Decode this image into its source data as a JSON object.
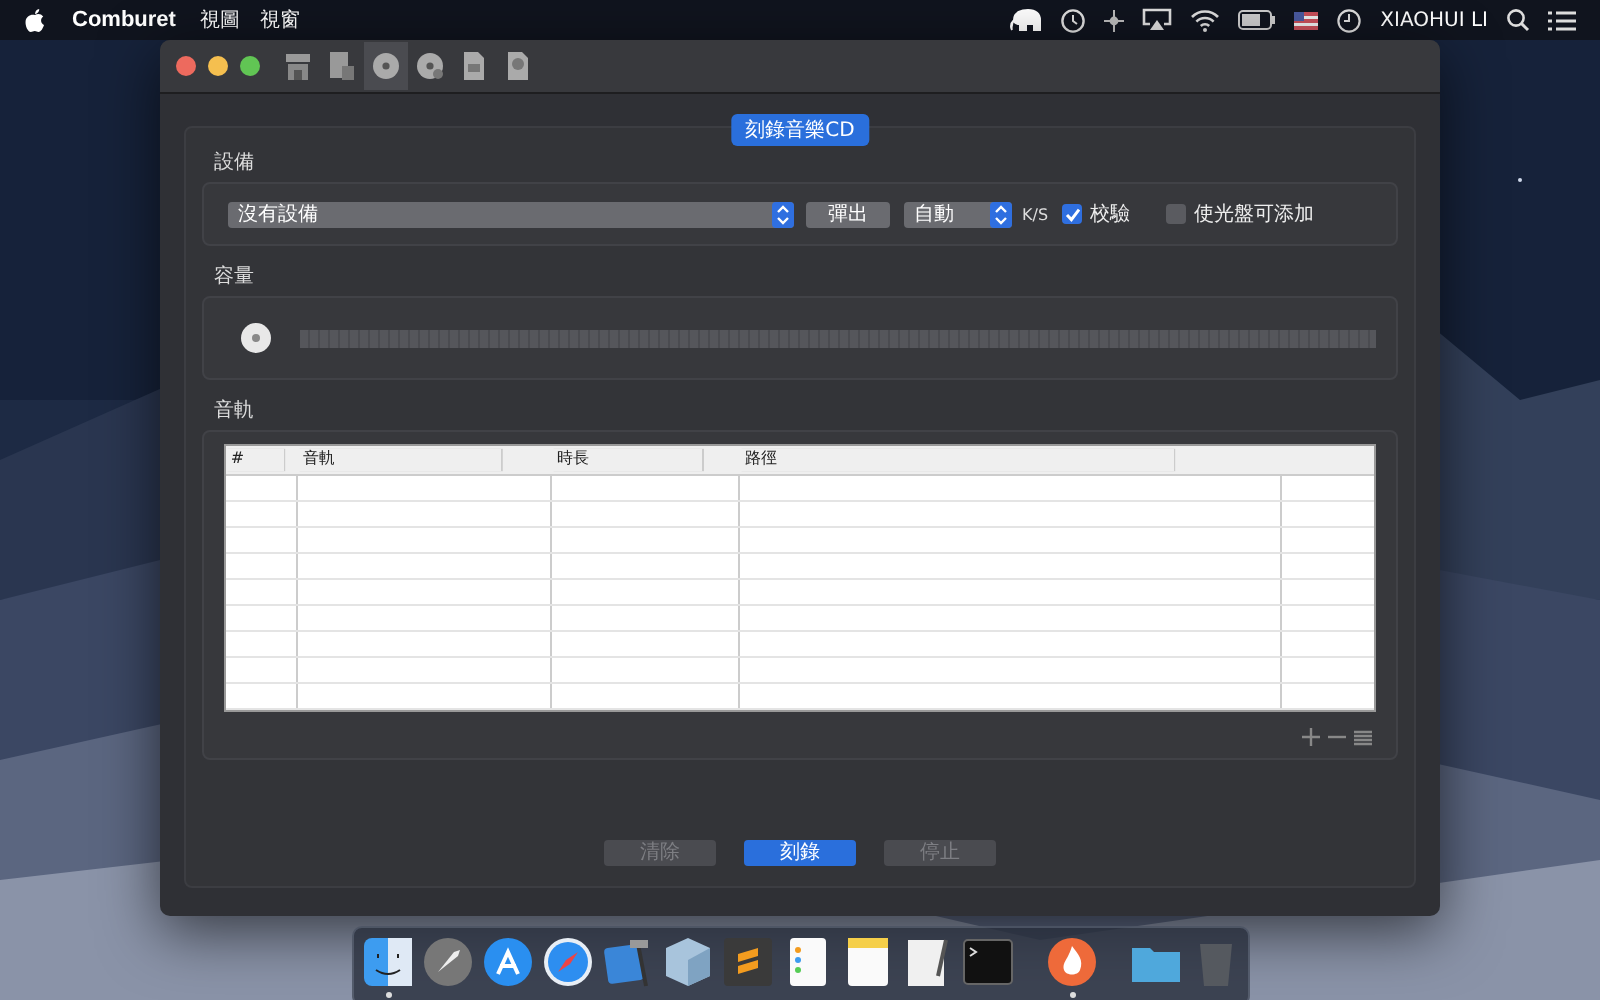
{
  "menubar": {
    "app_name": "Comburet",
    "menus": [
      "視圖",
      "視窗"
    ],
    "user": "XIAOHUI LI"
  },
  "toolbar": [
    {
      "kind": "store",
      "selected": false
    },
    {
      "kind": "doc",
      "selected": false
    },
    {
      "kind": "disc",
      "selected": true
    },
    {
      "kind": "disc-add",
      "selected": false
    },
    {
      "kind": "file",
      "selected": false
    },
    {
      "kind": "file-disc",
      "selected": false
    }
  ],
  "panel_title": "刻錄音樂CD",
  "device": {
    "label": "設備",
    "select_value": "沒有設備",
    "eject_button": "彈出",
    "speed_value": "自動",
    "speed_unit": "K/S",
    "options": [
      {
        "label": "校驗",
        "checked": true
      },
      {
        "label": "使光盤可添加",
        "checked": false
      }
    ]
  },
  "capacity": {
    "label": "容量"
  },
  "tracks": {
    "label": "音軌",
    "columns": [
      "#",
      "音軌",
      "時長",
      "路徑"
    ]
  },
  "buttons": [
    {
      "label": "清除",
      "disabled": true
    },
    {
      "label": "刻錄",
      "disabled": false
    },
    {
      "label": "停止",
      "disabled": true
    }
  ],
  "dock": [
    {
      "kind": "finder",
      "running": true
    },
    {
      "kind": "rocket",
      "running": false
    },
    {
      "kind": "appstore",
      "running": false
    },
    {
      "kind": "compass",
      "running": false
    },
    {
      "kind": "hammer",
      "running": false
    },
    {
      "kind": "cube",
      "running": false
    },
    {
      "kind": "editor",
      "running": false
    },
    {
      "kind": "list",
      "running": false
    },
    {
      "kind": "notes",
      "running": false
    },
    {
      "kind": "pen",
      "running": false
    },
    {
      "kind": "terminal",
      "running": false
    },
    {
      "kind": "flame",
      "running": true
    },
    {
      "kind": "folder",
      "running": false
    },
    {
      "kind": "trash",
      "running": false
    }
  ]
}
